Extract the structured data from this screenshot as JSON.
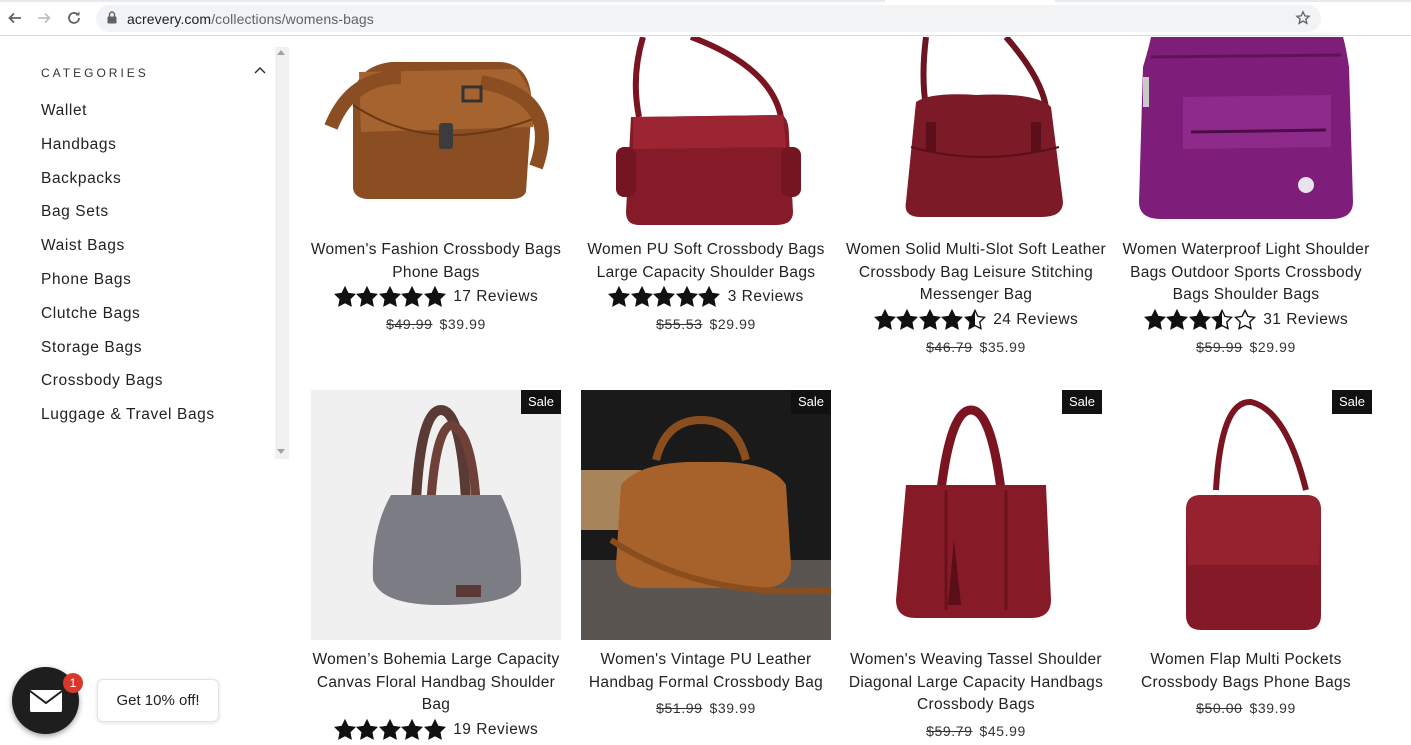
{
  "browser": {
    "url_domain": "acrevery.com",
    "url_path": "/collections/womens-bags"
  },
  "sidebar": {
    "title": "CATEGORIES",
    "items": [
      {
        "label": "Wallet"
      },
      {
        "label": "Handbags"
      },
      {
        "label": "Backpacks"
      },
      {
        "label": "Bag Sets"
      },
      {
        "label": "Waist Bags"
      },
      {
        "label": "Phone Bags"
      },
      {
        "label": "Clutche Bags"
      },
      {
        "label": "Storage Bags"
      },
      {
        "label": "Crossbody Bags"
      },
      {
        "label": "Luggage & Travel Bags"
      }
    ]
  },
  "products": [
    {
      "title": "Women's Fashion Crossbody Bags Phone Bags",
      "rating": 5,
      "reviews": "17 Reviews",
      "old_price": "$49.99",
      "price": "$39.99",
      "sale": "",
      "image": "brown-leather-crossbody-bag"
    },
    {
      "title": "Women PU Soft Crossbody Bags Large Capacity Shoulder Bags",
      "rating": 5,
      "reviews": "3 Reviews",
      "old_price": "$55.53",
      "price": "$29.99",
      "sale": "",
      "image": "burgundy-crossbody-bag"
    },
    {
      "title": "Women Solid Multi-Slot Soft Leather Crossbody Bag Leisure Stitching Messenger Bag",
      "rating": 4.5,
      "reviews": "24 Reviews",
      "old_price": "$46.79",
      "price": "$35.99",
      "sale": "",
      "image": "burgundy-messenger-bag"
    },
    {
      "title": "Women Waterproof Light Shoulder Bags Outdoor Sports Crossbody Bags Shoulder Bags",
      "rating": 3.5,
      "reviews": "31 Reviews",
      "old_price": "$59.99",
      "price": "$29.99",
      "sale": "",
      "image": "purple-nylon-shoulder-bag"
    },
    {
      "title": "Women’s Bohemia Large Capacity Canvas Floral Handbag Shoulder Bag",
      "rating": 5,
      "reviews": "19 Reviews",
      "old_price": "",
      "price": "",
      "sale": "Sale",
      "image": "grey-canvas-hobo-bag"
    },
    {
      "title": "Women's Vintage PU Leather Handbag Formal Crossbody Bag",
      "rating": 0,
      "reviews": "",
      "old_price": "$51.99",
      "price": "$39.99",
      "sale": "Sale",
      "image": "tan-leather-boston-bag"
    },
    {
      "title": "Women's Weaving Tassel Shoulder Diagonal Large Capacity Handbags Crossbody Bags",
      "rating": 0,
      "reviews": "",
      "old_price": "$59.79",
      "price": "$45.99",
      "sale": "Sale",
      "image": "burgundy-tassel-tote-bag"
    },
    {
      "title": "Women Flap Multi Pockets Crossbody Bags Phone Bags",
      "rating": 0,
      "reviews": "",
      "old_price": "$50.00",
      "price": "$39.99",
      "sale": "Sale",
      "image": "burgundy-flap-crossbody-bag"
    }
  ],
  "chat": {
    "badge_count": "1",
    "promo_text": "Get 10% off!"
  },
  "colors": {
    "accent_dark": "#111111",
    "badge_red": "#d9372b",
    "burgundy": "#7a1420"
  }
}
